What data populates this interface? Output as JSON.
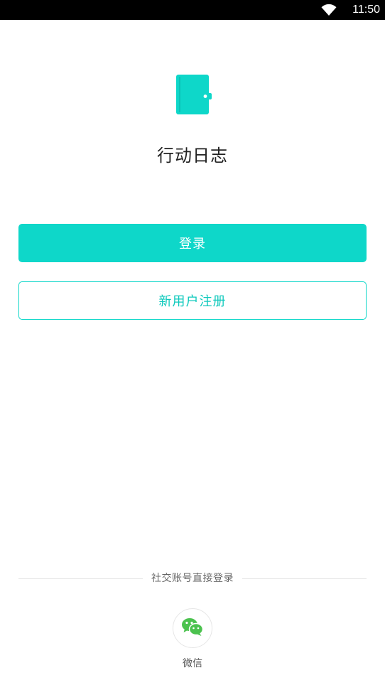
{
  "status_bar": {
    "time": "11:50",
    "wifi_icon": "wifi-icon"
  },
  "app": {
    "name": "行动日志",
    "logo_icon": "notebook-icon",
    "accent_color": "#0ed7c9"
  },
  "buttons": {
    "login_label": "登录",
    "register_label": "新用户注册"
  },
  "social": {
    "divider_label": "社交账号直接登录",
    "wechat_label": "微信",
    "wechat_icon": "wechat-icon",
    "wechat_color": "#4bc24e"
  }
}
